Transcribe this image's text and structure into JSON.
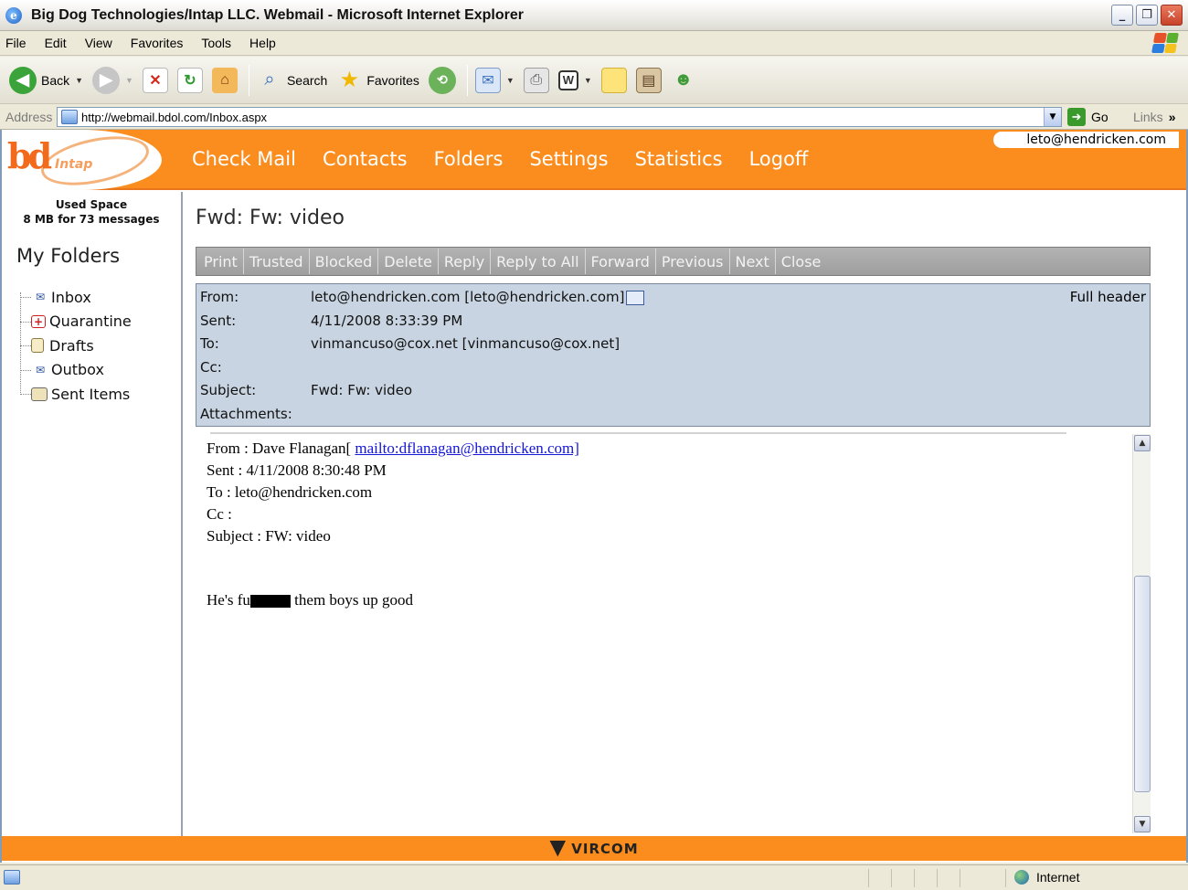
{
  "window": {
    "title": "Big Dog Technologies/Intap LLC. Webmail - Microsoft Internet Explorer",
    "minimize": "_",
    "restore": "❐",
    "close": "✕"
  },
  "menu": [
    "File",
    "Edit",
    "View",
    "Favorites",
    "Tools",
    "Help"
  ],
  "toolbar": {
    "back_label": "Back",
    "search_label": "Search",
    "favorites_label": "Favorites"
  },
  "address": {
    "label": "Address",
    "url": "http://webmail.bdol.com/Inbox.aspx",
    "go_label": "Go",
    "links_label": "Links"
  },
  "webmail": {
    "logo_text": "Intap",
    "nav": [
      "Check Mail",
      "Contacts",
      "Folders",
      "Settings",
      "Statistics",
      "Logoff"
    ],
    "user_email": "leto@hendricken.com",
    "used_space_title": "Used Space",
    "used_space_detail": "8 MB for 73 messages",
    "my_folders_title": "My Folders",
    "folders": [
      {
        "label": "Inbox",
        "icon": "inbox-icon"
      },
      {
        "label": "Quarantine",
        "icon": "quarantine-icon"
      },
      {
        "label": "Drafts",
        "icon": "drafts-icon"
      },
      {
        "label": "Outbox",
        "icon": "outbox-icon"
      },
      {
        "label": "Sent Items",
        "icon": "sent-items-icon"
      }
    ]
  },
  "message": {
    "title": "Fwd: Fw: video",
    "actions": [
      "Print",
      "Trusted",
      "Blocked",
      "Delete",
      "Reply",
      "Reply to All",
      "Forward",
      "Previous",
      "Next",
      "Close"
    ],
    "full_header_label": "Full header",
    "header_labels": {
      "from": "From:",
      "sent": "Sent:",
      "to": "To:",
      "cc": "Cc:",
      "subject": "Subject:",
      "attachments": "Attachments:"
    },
    "header_values": {
      "from": "leto@hendricken.com [leto@hendricken.com]",
      "sent": "4/11/2008 8:33:39 PM",
      "to": "vinmancuso@cox.net [vinmancuso@cox.net]",
      "cc": "",
      "subject": "Fwd: Fw: video",
      "attachments": ""
    },
    "body": {
      "from_prefix": "From : Dave Flanagan[ ",
      "from_link": "mailto:dflanagan@hendricken.com]",
      "sent_line": "Sent : 4/11/2008 8:30:48 PM",
      "to_line": "To : leto@hendricken.com",
      "cc_line": "Cc :",
      "subject_line": "Subject : FW: video",
      "text_before": "He's fu",
      "text_after": " them boys up good"
    }
  },
  "footer": {
    "brand": "VIRCOM"
  },
  "status": {
    "zone": "Internet"
  },
  "colors": {
    "brand_orange": "#fa8d1e",
    "header_panel": "#c8d4e1",
    "action_bar": "#a9a9a9",
    "link": "#1515d6"
  }
}
